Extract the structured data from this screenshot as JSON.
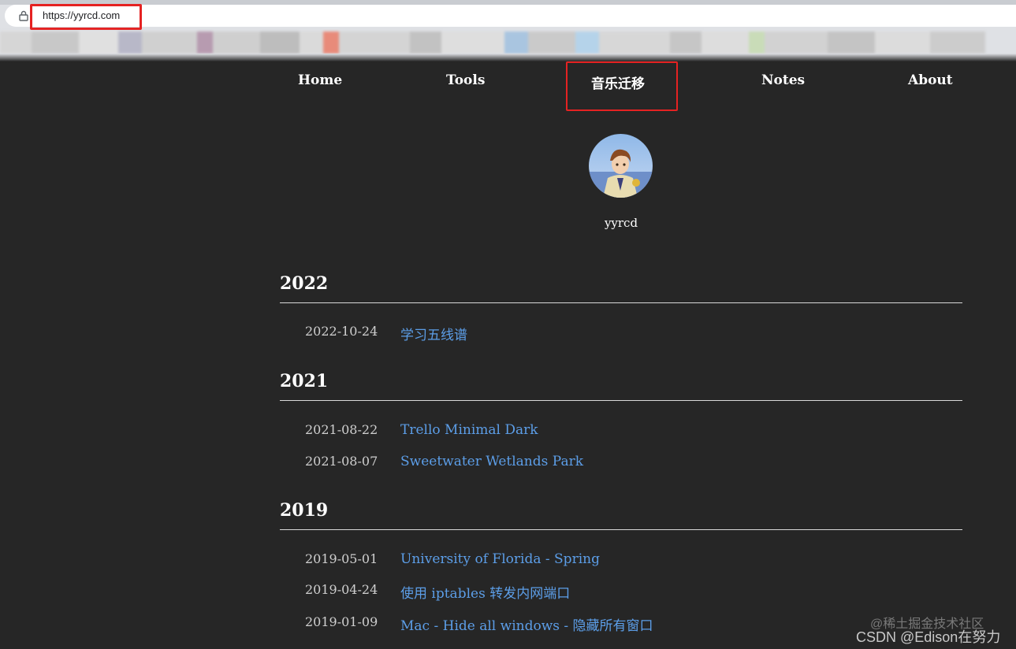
{
  "browser": {
    "url": "https://yyrcd.com"
  },
  "nav": {
    "items": [
      {
        "label": "Home"
      },
      {
        "label": "Tools"
      },
      {
        "label": "音乐迁移"
      },
      {
        "label": "Notes"
      },
      {
        "label": "About"
      }
    ]
  },
  "profile": {
    "username": "yyrcd"
  },
  "archive": [
    {
      "year": "2022",
      "posts": [
        {
          "date": "2022-10-24",
          "title": "学习五线谱"
        }
      ]
    },
    {
      "year": "2021",
      "posts": [
        {
          "date": "2021-08-22",
          "title": "Trello Minimal Dark"
        },
        {
          "date": "2021-08-07",
          "title": "Sweetwater Wetlands Park"
        }
      ]
    },
    {
      "year": "2019",
      "posts": [
        {
          "date": "2019-05-01",
          "title": "University of Florida - Spring"
        },
        {
          "date": "2019-04-24",
          "title": "使用 iptables 转发内网端口"
        },
        {
          "date": "2019-01-09",
          "title": "Mac - Hide all windows - 隐藏所有窗口"
        }
      ]
    }
  ],
  "watermark": {
    "line1": "@稀土掘金技术社区",
    "line2": "CSDN @Edison在努力"
  },
  "colors": {
    "background": "#262626",
    "link": "#5c9ee8",
    "highlight_box": "#e52222"
  }
}
